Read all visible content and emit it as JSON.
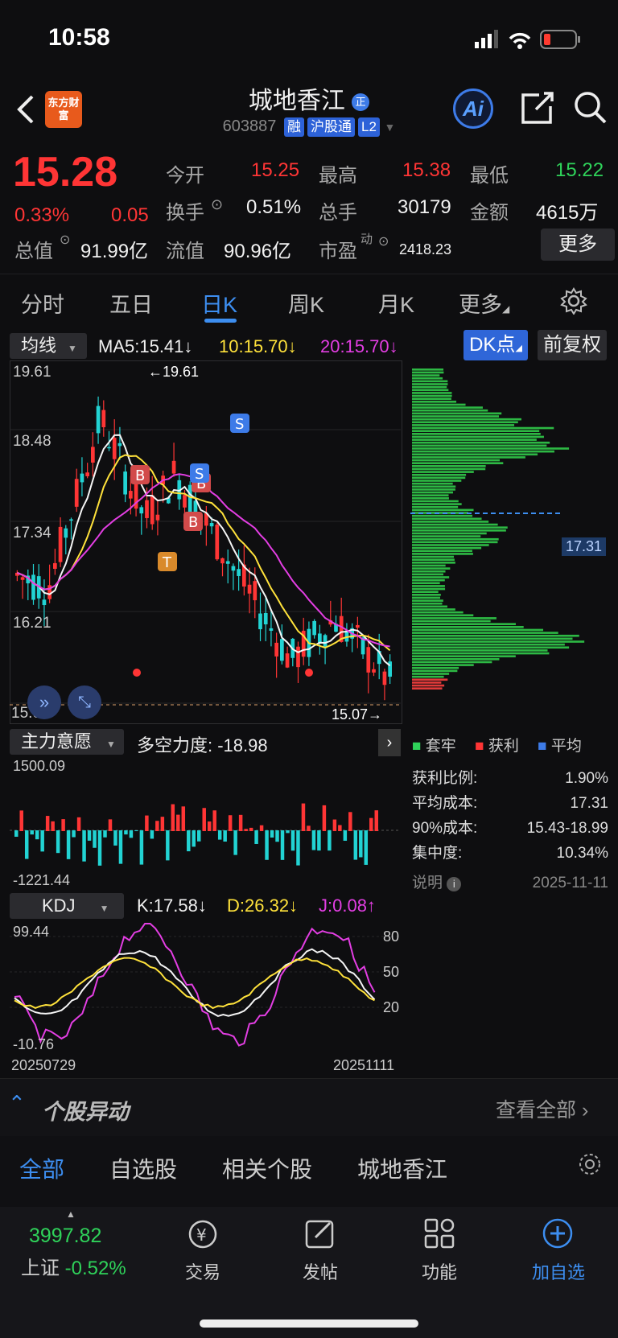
{
  "status_bar": {
    "time": "10:58"
  },
  "header": {
    "logo_text": "东方财富",
    "stock_name": "城地香江",
    "stock_code": "603887",
    "tags": [
      "融",
      "沪股通",
      "L2"
    ],
    "ai_label": "Ai"
  },
  "quote": {
    "price": "15.28",
    "change_pct": "0.33%",
    "change_amt": "0.05",
    "open_label": "今开",
    "open": "15.25",
    "high_label": "最高",
    "high": "15.38",
    "low_label": "最低",
    "low": "15.22",
    "turnover_label": "换手",
    "turnover": "0.51%",
    "volume_label": "总手",
    "volume": "30179",
    "amount_label": "金额",
    "amount": "4615万",
    "mktcap_label": "总值",
    "mktcap": "91.99亿",
    "float_label": "流值",
    "float": "90.96亿",
    "pe_label": "市盈",
    "pe_sup": "动",
    "pe": "2418.23",
    "more_button": "更多"
  },
  "tabs": [
    "分时",
    "五日",
    "日K",
    "周K",
    "月K",
    "更多"
  ],
  "active_tab": "日K",
  "kline": {
    "indicator_select": "均线",
    "ma5": "MA5:15.41↓",
    "ma10": "10:15.70↓",
    "ma20": "20:15.70↓",
    "dk_button": "DK点",
    "adjust_button": "前复权",
    "y_labels": [
      "19.61",
      "18.48",
      "17.34",
      "16.21",
      "15.07"
    ],
    "max_marker": "19.61",
    "min_marker": "15.07",
    "avg_cost_marker": "17.31"
  },
  "chips": {
    "legend": [
      "套牢",
      "获利",
      "平均"
    ],
    "rows": [
      {
        "label": "获利比例:",
        "value": "1.90%"
      },
      {
        "label": "平均成本:",
        "value": "17.31"
      },
      {
        "label": "90%成本:",
        "value": "15.43-18.99"
      },
      {
        "label": "集中度:",
        "value": "10.34%"
      }
    ],
    "note_label": "说明",
    "date": "2025-11-11"
  },
  "main_force": {
    "select": "主力意愿",
    "value_text": "多空力度: -18.98",
    "max": "1500.09",
    "min": "-1221.44"
  },
  "kdj": {
    "select": "KDJ",
    "k": "K:17.58↓",
    "d": "D:26.32↓",
    "j": "J:0.08↑",
    "max": "99.44",
    "min": "-10.76",
    "levels": [
      "80",
      "50",
      "20"
    ],
    "start_date": "20250729",
    "end_date": "20251111"
  },
  "news": {
    "title": "个股异动",
    "view_all": "查看全部",
    "tabs": [
      "全部",
      "自选股",
      "相关个股",
      "城地香江"
    ]
  },
  "bottom_nav": {
    "index_value": "3997.82",
    "index_name": "上证",
    "index_change": "-0.52%",
    "items": [
      "交易",
      "发帖",
      "功能",
      "加自选"
    ]
  }
}
